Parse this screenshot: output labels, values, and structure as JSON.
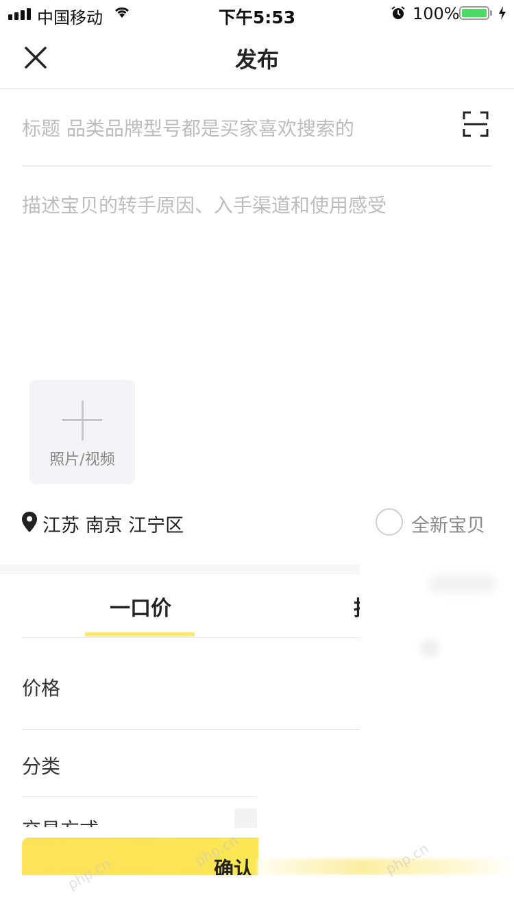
{
  "status_bar": {
    "carrier": "中国移动",
    "time": "下午5:53",
    "battery_pct": "100%",
    "battery_color": "#4cd964"
  },
  "nav": {
    "title": "发布"
  },
  "form": {
    "title_placeholder": "标题 品类品牌型号都是买家喜欢搜索的",
    "desc_placeholder": "描述宝贝的转手原因、入手渠道和使用感受",
    "photo_label": "照片/视频",
    "location": "江苏 南京 江宁区",
    "new_item_label": "全新宝贝"
  },
  "tabs": {
    "active": "一口价",
    "partial": "拍"
  },
  "rows": {
    "price": "价格",
    "category": "分类",
    "trade": "交易方式"
  },
  "actions": {
    "confirm": "确认"
  },
  "watermark": "php.cn",
  "colors": {
    "accent": "#fce86a",
    "placeholder": "#bdbdbd"
  }
}
